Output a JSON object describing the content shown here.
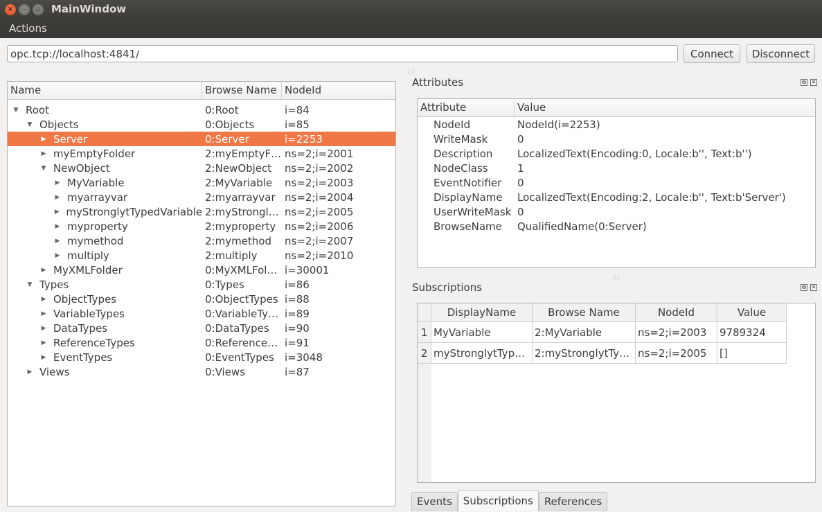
{
  "window": {
    "title": "MainWindow",
    "close_glyph": "×",
    "min_glyph": "–",
    "max_glyph": "▫"
  },
  "menubar": {
    "items": [
      "Actions"
    ]
  },
  "connection": {
    "url": "opc.tcp://localhost:4841/",
    "connect_label": "Connect",
    "disconnect_label": "Disconnect"
  },
  "tree": {
    "headers": [
      "Name",
      "Browse Name",
      "NodeId"
    ],
    "rows": [
      {
        "depth": 0,
        "expanded": true,
        "name": "Root",
        "browse": "0:Root",
        "nodeid": "i=84",
        "selected": false
      },
      {
        "depth": 1,
        "expanded": true,
        "name": "Objects",
        "browse": "0:Objects",
        "nodeid": "i=85",
        "selected": false
      },
      {
        "depth": 2,
        "expanded": false,
        "name": "Server",
        "browse": "0:Server",
        "nodeid": "i=2253",
        "selected": true
      },
      {
        "depth": 2,
        "expanded": false,
        "name": "myEmptyFolder",
        "browse": "2:myEmptyF…",
        "nodeid": "ns=2;i=2001",
        "selected": false
      },
      {
        "depth": 2,
        "expanded": true,
        "name": "NewObject",
        "browse": "2:NewObject",
        "nodeid": "ns=2;i=2002",
        "selected": false
      },
      {
        "depth": 3,
        "expanded": false,
        "name": "MyVariable",
        "browse": "2:MyVariable",
        "nodeid": "ns=2;i=2003",
        "selected": false
      },
      {
        "depth": 3,
        "expanded": false,
        "name": "myarrayvar",
        "browse": "2:myarrayvar",
        "nodeid": "ns=2;i=2004",
        "selected": false
      },
      {
        "depth": 3,
        "expanded": false,
        "name": "myStronglytTypedVariable",
        "browse": "2:myStrongl…",
        "nodeid": "ns=2;i=2005",
        "selected": false
      },
      {
        "depth": 3,
        "expanded": false,
        "name": "myproperty",
        "browse": "2:myproperty",
        "nodeid": "ns=2;i=2006",
        "selected": false
      },
      {
        "depth": 3,
        "expanded": false,
        "name": "mymethod",
        "browse": "2:mymethod",
        "nodeid": "ns=2;i=2007",
        "selected": false
      },
      {
        "depth": 3,
        "expanded": false,
        "name": "multiply",
        "browse": "2:multiply",
        "nodeid": "ns=2;i=2010",
        "selected": false
      },
      {
        "depth": 2,
        "expanded": false,
        "name": "MyXMLFolder",
        "browse": "0:MyXMLFol…",
        "nodeid": "i=30001",
        "selected": false
      },
      {
        "depth": 1,
        "expanded": true,
        "name": "Types",
        "browse": "0:Types",
        "nodeid": "i=86",
        "selected": false
      },
      {
        "depth": 2,
        "expanded": false,
        "name": "ObjectTypes",
        "browse": "0:ObjectTypes",
        "nodeid": "i=88",
        "selected": false
      },
      {
        "depth": 2,
        "expanded": false,
        "name": "VariableTypes",
        "browse": "0:VariableTy…",
        "nodeid": "i=89",
        "selected": false
      },
      {
        "depth": 2,
        "expanded": false,
        "name": "DataTypes",
        "browse": "0:DataTypes",
        "nodeid": "i=90",
        "selected": false
      },
      {
        "depth": 2,
        "expanded": false,
        "name": "ReferenceTypes",
        "browse": "0:Reference…",
        "nodeid": "i=91",
        "selected": false
      },
      {
        "depth": 2,
        "expanded": false,
        "name": "EventTypes",
        "browse": "0:EventTypes",
        "nodeid": "i=3048",
        "selected": false
      },
      {
        "depth": 1,
        "expanded": false,
        "name": "Views",
        "browse": "0:Views",
        "nodeid": "i=87",
        "selected": false
      }
    ]
  },
  "attributes": {
    "title": "Attributes",
    "headers": [
      "Attribute",
      "Value"
    ],
    "rows": [
      {
        "attr": "NodeId",
        "value": "NodeId(i=2253)"
      },
      {
        "attr": "WriteMask",
        "value": "0"
      },
      {
        "attr": "Description",
        "value": "LocalizedText(Encoding:0, Locale:b'', Text:b'')"
      },
      {
        "attr": "NodeClass",
        "value": "1"
      },
      {
        "attr": "EventNotifier",
        "value": "0"
      },
      {
        "attr": "DisplayName",
        "value": "LocalizedText(Encoding:2, Locale:b'', Text:b'Server')"
      },
      {
        "attr": "UserWriteMask",
        "value": "0"
      },
      {
        "attr": "BrowseName",
        "value": "QualifiedName(0:Server)"
      }
    ]
  },
  "subscriptions": {
    "title": "Subscriptions",
    "headers": [
      "DisplayName",
      "Browse Name",
      "NodeId",
      "Value"
    ],
    "rows": [
      {
        "index": "1",
        "display": "MyVariable",
        "browse": "2:MyVariable",
        "nodeid": "ns=2;i=2003",
        "value": "9789324"
      },
      {
        "index": "2",
        "display": "myStronglytTyp…",
        "browse": "2:myStronglytTy…",
        "nodeid": "ns=2;i=2005",
        "value": "[]"
      }
    ]
  },
  "dock_buttons": {
    "float_glyph": "⧉",
    "close_glyph": "✕"
  },
  "bottom_tabs": {
    "items": [
      "Events",
      "Subscriptions",
      "References"
    ],
    "active": "Subscriptions"
  }
}
